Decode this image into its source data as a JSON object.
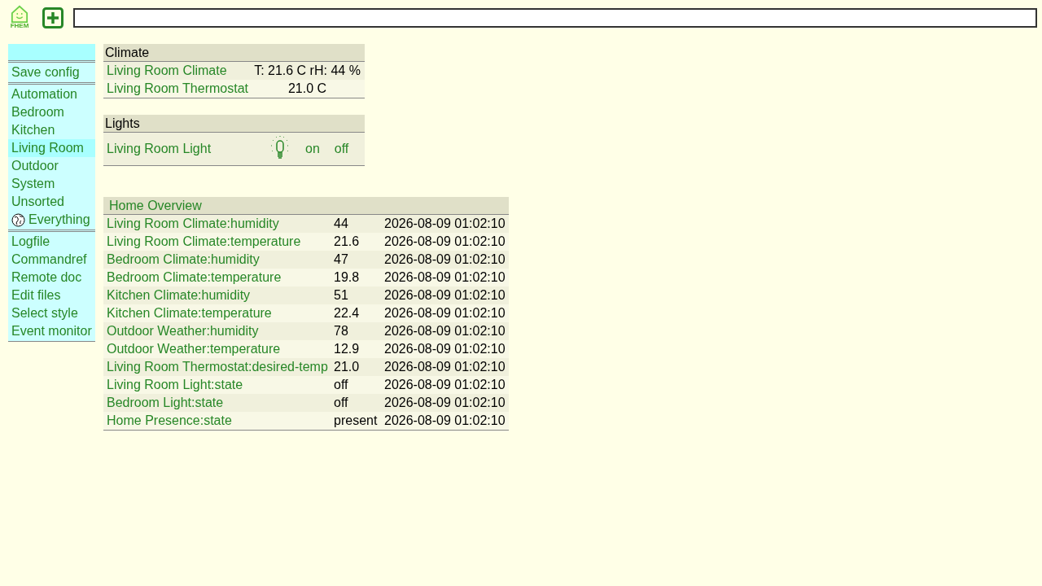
{
  "header": {
    "logo_text": "FHEM"
  },
  "sidebar": {
    "groups": [
      {
        "items": [
          {
            "label": "Save config",
            "kind": "plain",
            "selected": false
          }
        ]
      },
      {
        "items": [
          {
            "label": "Automation",
            "kind": "plain",
            "selected": false
          },
          {
            "label": "Bedroom",
            "kind": "plain",
            "selected": false
          },
          {
            "label": "Kitchen",
            "kind": "plain",
            "selected": false
          },
          {
            "label": "Living Room",
            "kind": "plain",
            "selected": true
          },
          {
            "label": "Outdoor",
            "kind": "plain",
            "selected": false
          },
          {
            "label": "System",
            "kind": "plain",
            "selected": false
          },
          {
            "label": "Unsorted",
            "kind": "plain",
            "selected": false
          },
          {
            "label": "Everything",
            "kind": "globe",
            "selected": false
          }
        ]
      },
      {
        "items": [
          {
            "label": "Logfile",
            "kind": "plain",
            "selected": false
          },
          {
            "label": "Commandref",
            "kind": "plain",
            "selected": false
          },
          {
            "label": "Remote doc",
            "kind": "plain",
            "selected": false
          },
          {
            "label": "Edit files",
            "kind": "plain",
            "selected": false
          },
          {
            "label": "Select style",
            "kind": "plain",
            "selected": false
          },
          {
            "label": "Event monitor",
            "kind": "plain",
            "selected": false
          }
        ]
      }
    ]
  },
  "rooms": [
    {
      "title": "Climate",
      "devices": [
        {
          "name": "Living Room Climate",
          "kind": "reading",
          "state": "T: 21.6 C rH: 44 %"
        },
        {
          "name": "Living Room Thermostat",
          "kind": "reading",
          "state": "21.0 C"
        }
      ]
    },
    {
      "title": "Lights",
      "devices": [
        {
          "name": "Living Room Light",
          "kind": "switch",
          "commands": [
            "on",
            "off"
          ]
        }
      ]
    }
  ],
  "overview": {
    "title": "Home Overview",
    "rows": [
      {
        "reading": "Living Room Climate:humidity",
        "value": "44",
        "time": "2026-08-09 01:02:10"
      },
      {
        "reading": "Living Room Climate:temperature",
        "value": "21.6",
        "time": "2026-08-09 01:02:10"
      },
      {
        "reading": "Bedroom Climate:humidity",
        "value": "47",
        "time": "2026-08-09 01:02:10"
      },
      {
        "reading": "Bedroom Climate:temperature",
        "value": "19.8",
        "time": "2026-08-09 01:02:10"
      },
      {
        "reading": "Kitchen Climate:humidity",
        "value": "51",
        "time": "2026-08-09 01:02:10"
      },
      {
        "reading": "Kitchen Climate:temperature",
        "value": "22.4",
        "time": "2026-08-09 01:02:10"
      },
      {
        "reading": "Outdoor Weather:humidity",
        "value": "78",
        "time": "2026-08-09 01:02:10"
      },
      {
        "reading": "Outdoor Weather:temperature",
        "value": "12.9",
        "time": "2026-08-09 01:02:10"
      },
      {
        "reading": "Living Room Thermostat:desired-temp",
        "value": "21.0",
        "time": "2026-08-09 01:02:10"
      },
      {
        "reading": "Living Room Light:state",
        "value": "off",
        "time": "2026-08-09 01:02:10"
      },
      {
        "reading": "Bedroom Light:state",
        "value": "off",
        "time": "2026-08-09 01:02:10"
      },
      {
        "reading": "Home Presence:state",
        "value": "present",
        "time": "2026-08-09 01:02:10"
      }
    ]
  }
}
